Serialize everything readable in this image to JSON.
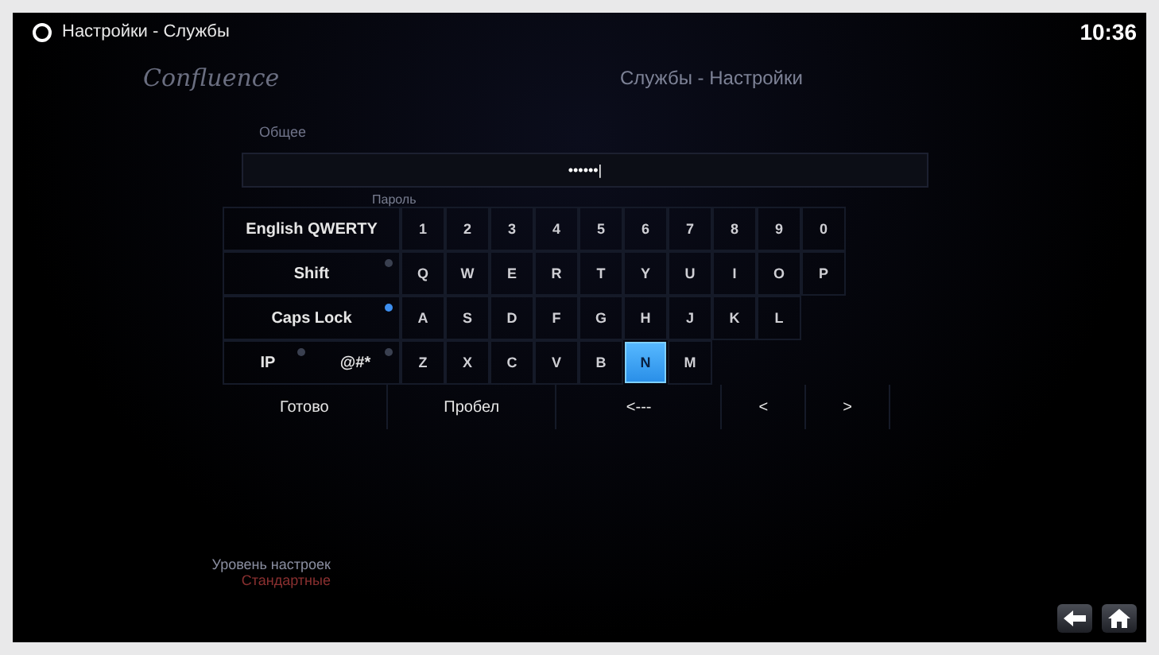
{
  "top_bar": {
    "title": "Настройки - Службы",
    "clock": "10:36"
  },
  "logo": "Confluence",
  "heading": "Службы - Настройки",
  "category": "Общее",
  "password_field": {
    "value": "••••••|"
  },
  "field_label": "Пароль",
  "keyboard": {
    "layout": "English QWERTY",
    "number_keys": [
      {
        "label": "1",
        "selected": false
      },
      {
        "label": "2",
        "selected": false
      },
      {
        "label": "3",
        "selected": false
      },
      {
        "label": "4",
        "selected": false
      },
      {
        "label": "5",
        "selected": false
      },
      {
        "label": "6",
        "selected": false
      },
      {
        "label": "7",
        "selected": false
      },
      {
        "label": "8",
        "selected": false
      },
      {
        "label": "9",
        "selected": false
      },
      {
        "label": "0",
        "selected": false
      }
    ],
    "rows": [
      {
        "modifiers": [
          {
            "label": "Shift",
            "on": false
          }
        ],
        "keys": [
          {
            "label": "Q",
            "selected": false
          },
          {
            "label": "W",
            "selected": false
          },
          {
            "label": "E",
            "selected": false
          },
          {
            "label": "R",
            "selected": false
          },
          {
            "label": "T",
            "selected": false
          },
          {
            "label": "Y",
            "selected": false
          },
          {
            "label": "U",
            "selected": false
          },
          {
            "label": "I",
            "selected": false
          },
          {
            "label": "O",
            "selected": false
          },
          {
            "label": "P",
            "selected": false
          }
        ]
      },
      {
        "modifiers": [
          {
            "label": "Caps Lock",
            "on": true
          }
        ],
        "keys": [
          {
            "label": "A",
            "selected": false
          },
          {
            "label": "S",
            "selected": false
          },
          {
            "label": "D",
            "selected": false
          },
          {
            "label": "F",
            "selected": false
          },
          {
            "label": "G",
            "selected": false
          },
          {
            "label": "H",
            "selected": false
          },
          {
            "label": "J",
            "selected": false
          },
          {
            "label": "K",
            "selected": false
          },
          {
            "label": "L",
            "selected": false
          }
        ]
      },
      {
        "modifiers": [
          {
            "label": "IP",
            "on": false
          },
          {
            "label": "@#*",
            "on": false
          }
        ],
        "keys": [
          {
            "label": "Z",
            "selected": false
          },
          {
            "label": "X",
            "selected": false
          },
          {
            "label": "C",
            "selected": false
          },
          {
            "label": "V",
            "selected": false
          },
          {
            "label": "B",
            "selected": false
          },
          {
            "label": "N",
            "selected": true
          },
          {
            "label": "M",
            "selected": false
          }
        ]
      }
    ],
    "bottom_keys": [
      {
        "label": "Готово",
        "kind": "done"
      },
      {
        "label": "Пробел",
        "kind": "space"
      },
      {
        "label": "<---",
        "kind": "backspace"
      },
      {
        "label": "<",
        "kind": "left"
      },
      {
        "label": ">",
        "kind": "right"
      }
    ]
  },
  "settings_level": {
    "label": "Уровень настроек",
    "value": "Стандартные"
  }
}
